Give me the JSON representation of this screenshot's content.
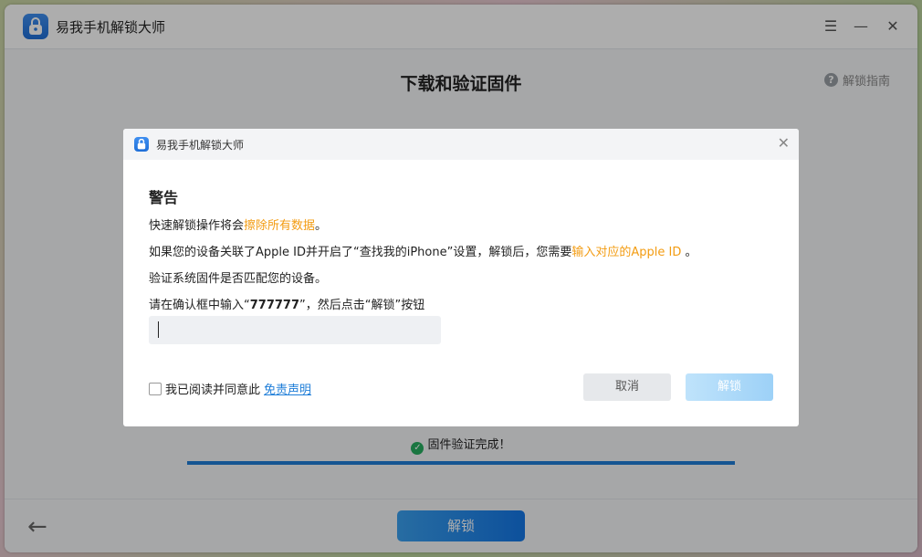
{
  "app": {
    "title": "易我手机解锁大师",
    "icon": "lock-icon"
  },
  "window_controls": {
    "menu_icon": "menu-icon",
    "minimize_icon": "minimize-icon",
    "close_icon": "close-icon"
  },
  "main": {
    "title": "下载和验证固件",
    "help_label": "解锁指南",
    "status_text": "固件验证完成！",
    "progress_percent": 100,
    "unlock_button": "解锁",
    "back_icon": "back-arrow-icon"
  },
  "dialog": {
    "title": "易我手机解锁大师",
    "heading": "警告",
    "line1_prefix": "快速解锁操作将会",
    "line1_highlight": "擦除所有数据",
    "line1_suffix": "。",
    "line2_prefix": "如果您的设备关联了Apple ID并开启了“查找我的iPhone”设置，解锁后，您需要",
    "line2_highlight": "输入对应的Apple ID",
    "line2_suffix": " 。",
    "line3": "验证系统固件是否匹配您的设备。",
    "line4_prefix": "请在确认框中输入“",
    "line4_code": "777777",
    "line4_suffix": "”，然后点击“解锁”按钮",
    "input_value": "",
    "agree_text": "我已阅读并同意此",
    "agree_link": "免责声明",
    "cancel_button": "取消",
    "unlock_button": "解锁"
  },
  "colors": {
    "accent": "#1f7ed8",
    "warning_highlight": "#f39c12",
    "success": "#27ae60"
  }
}
